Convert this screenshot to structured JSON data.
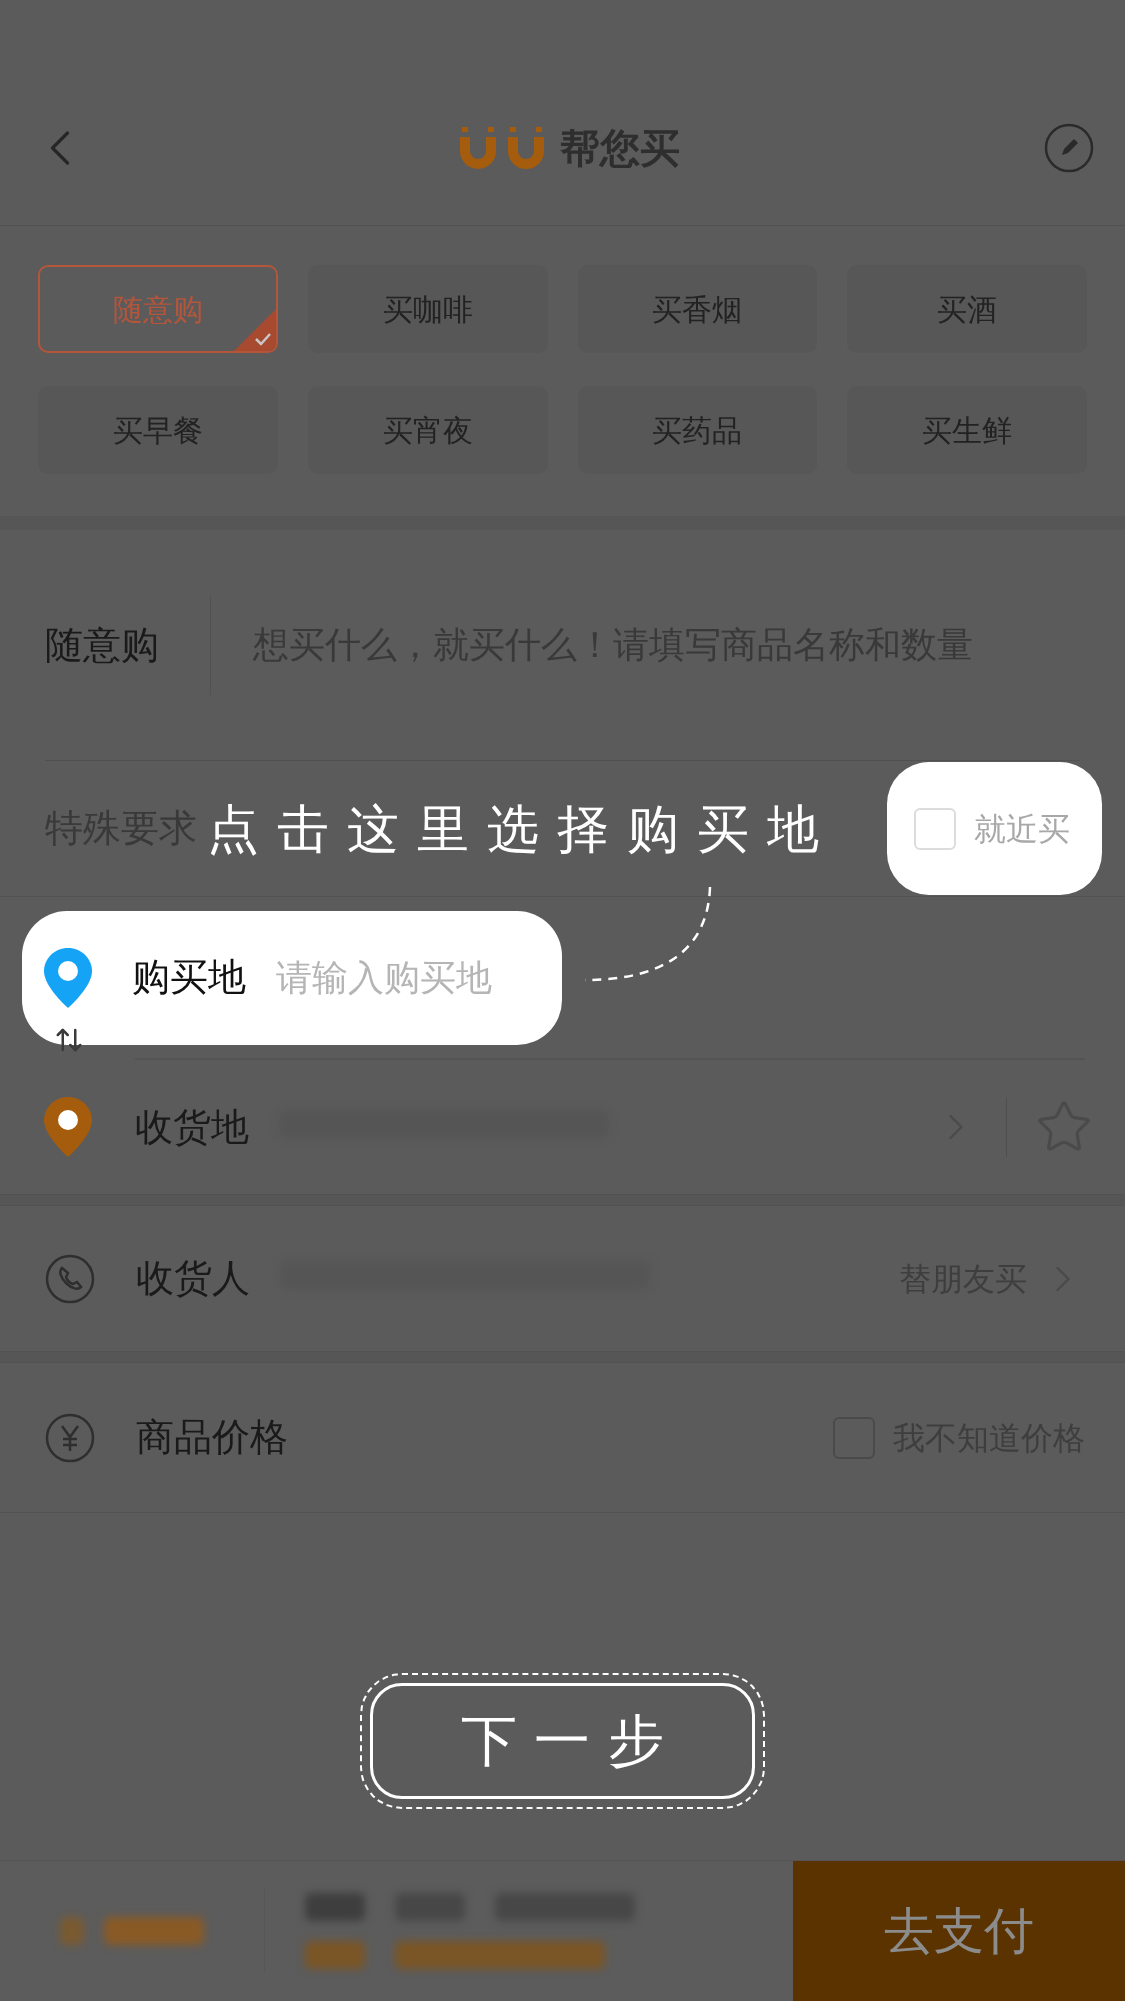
{
  "header": {
    "title": "帮您买"
  },
  "categories": [
    {
      "label": "随意购",
      "selected": true
    },
    {
      "label": "买咖啡",
      "selected": false
    },
    {
      "label": "买香烟",
      "selected": false
    },
    {
      "label": "买酒",
      "selected": false
    },
    {
      "label": "买早餐",
      "selected": false
    },
    {
      "label": "买宵夜",
      "selected": false
    },
    {
      "label": "买药品",
      "selected": false
    },
    {
      "label": "买生鲜",
      "selected": false
    }
  ],
  "item": {
    "label": "随意购",
    "placeholder": "想买什么，就买什么！请填写商品名称和数量"
  },
  "special": {
    "label": "特殊要求"
  },
  "guide": {
    "caption": "点击这里选择购买地",
    "nearby": {
      "label": "就近买",
      "checked": false
    },
    "purchase_place": {
      "label": "购买地",
      "placeholder": "请输入购买地"
    },
    "next_button": "下 一 步"
  },
  "delivery": {
    "label": "收货地"
  },
  "receiver": {
    "label": "收货人",
    "action": "替朋友买"
  },
  "price": {
    "label": "商品价格",
    "unknown": {
      "label": "我不知道价格",
      "checked": false
    }
  },
  "bottom_bar": {
    "pay_button": "去支付"
  }
}
